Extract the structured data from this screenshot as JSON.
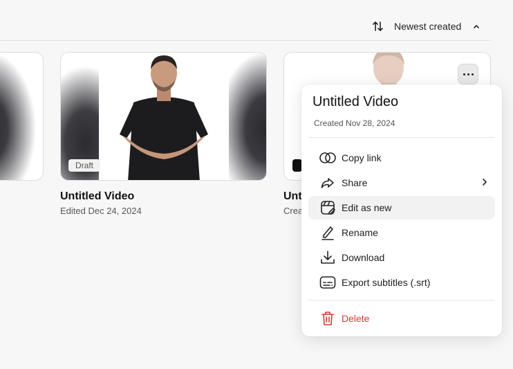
{
  "sort": {
    "label": "Newest created"
  },
  "cards": [
    {
      "title": "",
      "subtitle": ""
    },
    {
      "badge": "Draft",
      "title": "Untitled Video",
      "subtitle": "Edited Dec 24, 2024"
    },
    {
      "title": "Unt",
      "subtitle": "Crea"
    }
  ],
  "menu": {
    "title": "Untitled Video",
    "created": "Created Nov 28, 2024",
    "items": [
      {
        "label": "Copy link",
        "icon": "link-icon"
      },
      {
        "label": "Share",
        "icon": "share-icon"
      },
      {
        "label": "Edit as new",
        "icon": "edit-as-new-icon"
      },
      {
        "label": "Rename",
        "icon": "pencil-icon"
      },
      {
        "label": "Download",
        "icon": "download-icon"
      },
      {
        "label": "Export subtitles (.srt)",
        "icon": "subtitles-icon"
      }
    ],
    "delete_label": "Delete"
  },
  "colors": {
    "danger": "#d7392f",
    "hover": "#f2f2f2"
  }
}
